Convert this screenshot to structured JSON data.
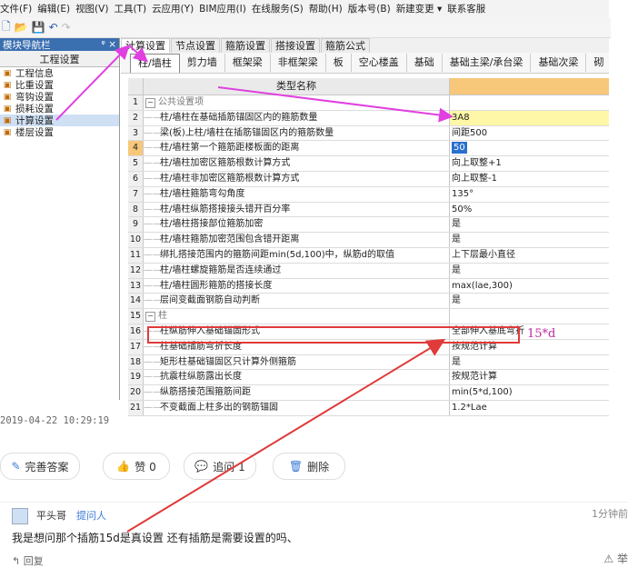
{
  "menu": [
    "文件(F)",
    "编辑(E)",
    "视图(V)",
    "工具(T)",
    "云应用(Y)",
    "BIM应用(I)",
    "在线服务(S)",
    "帮助(H)",
    "版本号(B)",
    "新建变更 ▾",
    "联系客服"
  ],
  "sidebar": {
    "title": "模块导航栏",
    "pin": "ᵠ ×",
    "header": "工程设置",
    "items": [
      {
        "label": "工程信息",
        "icon": "info-icon"
      },
      {
        "label": "比重设置",
        "icon": "ratio-icon"
      },
      {
        "label": "弯钩设置",
        "icon": "hook-icon"
      },
      {
        "label": "损耗设置",
        "icon": "loss-icon"
      },
      {
        "label": "计算设置",
        "icon": "calc-icon"
      },
      {
        "label": "楼层设置",
        "icon": "floor-icon"
      }
    ],
    "selected_index": 4
  },
  "tabs1": [
    "计算设置",
    "节点设置",
    "箍筋设置",
    "搭接设置",
    "箍筋公式"
  ],
  "tabs2": [
    "柱/墙柱",
    "剪力墙",
    "框架梁",
    "非框架梁",
    "板",
    "空心楼盖",
    "基础",
    "基础主梁/承台梁",
    "基础次梁",
    "砌"
  ],
  "grid": {
    "header": "类型名称",
    "rows": [
      {
        "n": "1",
        "name": "公共设置项",
        "val": "",
        "group": true
      },
      {
        "n": "2",
        "name": "柱/墙柱在基础插筋锚固区内的箍筋数量",
        "val": "3A8"
      },
      {
        "n": "3",
        "name": "梁(板)上柱/墙柱在插筋锚固区内的箍筋数量",
        "val": "间距500"
      },
      {
        "n": "4",
        "name": "柱/墙柱第一个箍筋距楼板面的距离",
        "val": "50"
      },
      {
        "n": "5",
        "name": "柱/墙柱加密区箍筋根数计算方式",
        "val": "向上取整+1"
      },
      {
        "n": "6",
        "name": "柱/墙柱非加密区箍筋根数计算方式",
        "val": "向上取整-1"
      },
      {
        "n": "7",
        "name": "柱/墙柱箍筋弯勾角度",
        "val": "135°"
      },
      {
        "n": "8",
        "name": "柱/墙柱纵筋搭接接头错开百分率",
        "val": "50%"
      },
      {
        "n": "9",
        "name": "柱/墙柱搭接部位箍筋加密",
        "val": "是"
      },
      {
        "n": "10",
        "name": "柱/墙柱箍筋加密范围包含错开距离",
        "val": "是"
      },
      {
        "n": "11",
        "name": "绑扎搭接范围内的箍筋间距min(5d,100)中，纵筋d的取值",
        "val": "上下层最小直径"
      },
      {
        "n": "12",
        "name": "柱/墙柱螺旋箍筋是否连续通过",
        "val": "是"
      },
      {
        "n": "13",
        "name": "柱/墙柱圆形箍筋的搭接长度",
        "val": "max(lae,300)"
      },
      {
        "n": "14",
        "name": "层间变截面钢筋自动判断",
        "val": "是"
      },
      {
        "n": "15",
        "name": "柱",
        "val": "",
        "group": true
      },
      {
        "n": "16",
        "name": "柱纵筋伸入基础锚固形式",
        "val": "全部伸入基底弯折"
      },
      {
        "n": "17",
        "name": "柱基础插筋弯折长度",
        "val": "按规范计算"
      },
      {
        "n": "18",
        "name": "矩形柱基础锚固区只计算外侧箍筋",
        "val": "是"
      },
      {
        "n": "19",
        "name": "抗震柱纵筋露出长度",
        "val": "按规范计算"
      },
      {
        "n": "20",
        "name": "纵筋搭接范围箍筋间距",
        "val": "min(5*d,100)"
      },
      {
        "n": "21",
        "name": "不变截面上柱多出的钢筋锚固",
        "val": "1.2*Lae"
      }
    ]
  },
  "annotation": "15*d",
  "timestamp": "2019-04-22 10:29:19",
  "actions": {
    "improve": "完善答案",
    "like": "赞 0",
    "followup": "追问 1",
    "delete": "删除"
  },
  "question": {
    "user": "平头哥",
    "role": "提问人",
    "time": "1分钟前",
    "text": "我是想问那个插筋15d是真设置  还有插筋是需要设置的吗、",
    "reply": "回复",
    "report": "举"
  },
  "colors": {
    "accent": "#3a7bd5",
    "highlight": "#fff7a8",
    "header_orange": "#f7c77a",
    "red": "#e03a3a",
    "magenta": "#e040e0"
  }
}
